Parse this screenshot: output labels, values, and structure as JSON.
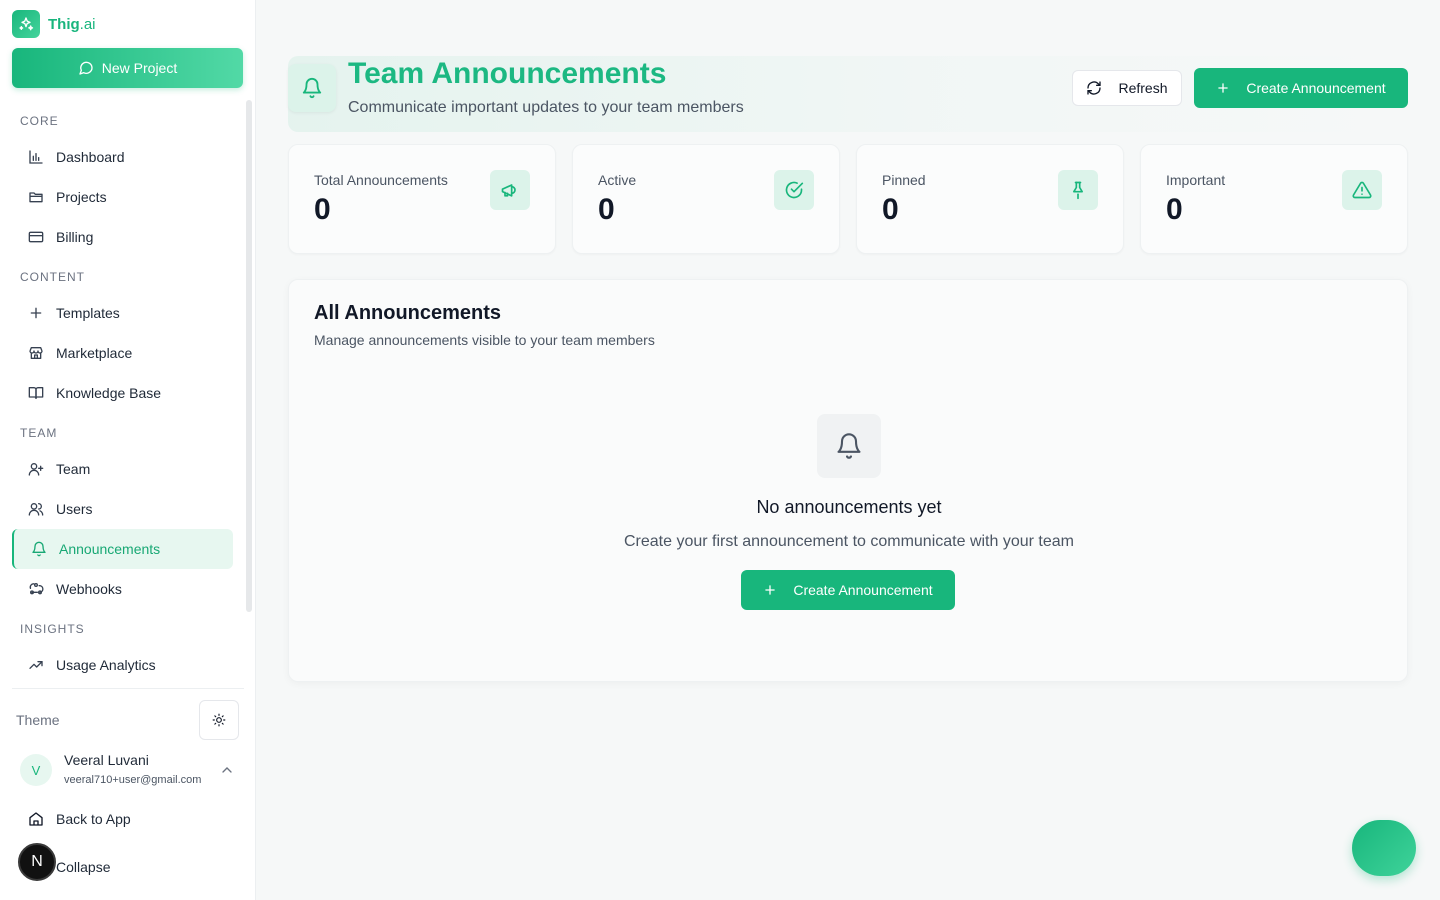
{
  "brand": {
    "name": "Thig",
    "suffix": ".ai"
  },
  "sidebar": {
    "new_project_label": "New Project",
    "sections": [
      {
        "label": "CORE",
        "items": [
          {
            "label": "Dashboard",
            "icon": "bar-chart-icon"
          },
          {
            "label": "Projects",
            "icon": "folder-icon"
          },
          {
            "label": "Billing",
            "icon": "credit-card-icon"
          }
        ]
      },
      {
        "label": "CONTENT",
        "items": [
          {
            "label": "Templates",
            "icon": "plus-icon"
          },
          {
            "label": "Marketplace",
            "icon": "store-icon"
          },
          {
            "label": "Knowledge Base",
            "icon": "book-icon"
          }
        ]
      },
      {
        "label": "TEAM",
        "items": [
          {
            "label": "Team",
            "icon": "user-plus-icon"
          },
          {
            "label": "Users",
            "icon": "users-icon"
          },
          {
            "label": "Announcements",
            "icon": "bell-icon",
            "active": true
          },
          {
            "label": "Webhooks",
            "icon": "webhook-icon"
          }
        ]
      },
      {
        "label": "INSIGHTS",
        "items": [
          {
            "label": "Usage Analytics",
            "icon": "trending-up-icon"
          }
        ]
      }
    ],
    "theme_label": "Theme",
    "user": {
      "initial": "V",
      "name": "Veeral Luvani",
      "email": "veeral710+user@gmail.com"
    },
    "back_to_app": "Back to App",
    "collapse": "Collapse",
    "badge_letter": "N"
  },
  "header": {
    "title": "Team Announcements",
    "subtitle": "Communicate important updates to your team members",
    "refresh_label": "Refresh",
    "create_label": "Create Announcement"
  },
  "stats": [
    {
      "label": "Total Announcements",
      "value": "0",
      "icon": "megaphone-icon"
    },
    {
      "label": "Active",
      "value": "0",
      "icon": "check-circle-icon"
    },
    {
      "label": "Pinned",
      "value": "0",
      "icon": "pin-icon"
    },
    {
      "label": "Important",
      "value": "0",
      "icon": "alert-triangle-icon"
    }
  ],
  "panel": {
    "title": "All Announcements",
    "subtitle": "Manage announcements visible to your team members",
    "empty_title": "No announcements yet",
    "empty_subtitle": "Create your first announcement to communicate with your team",
    "create_label": "Create Announcement"
  },
  "colors": {
    "accent": "#18b67c",
    "accent_light": "#dcf3ea",
    "text": "#1f2937"
  }
}
